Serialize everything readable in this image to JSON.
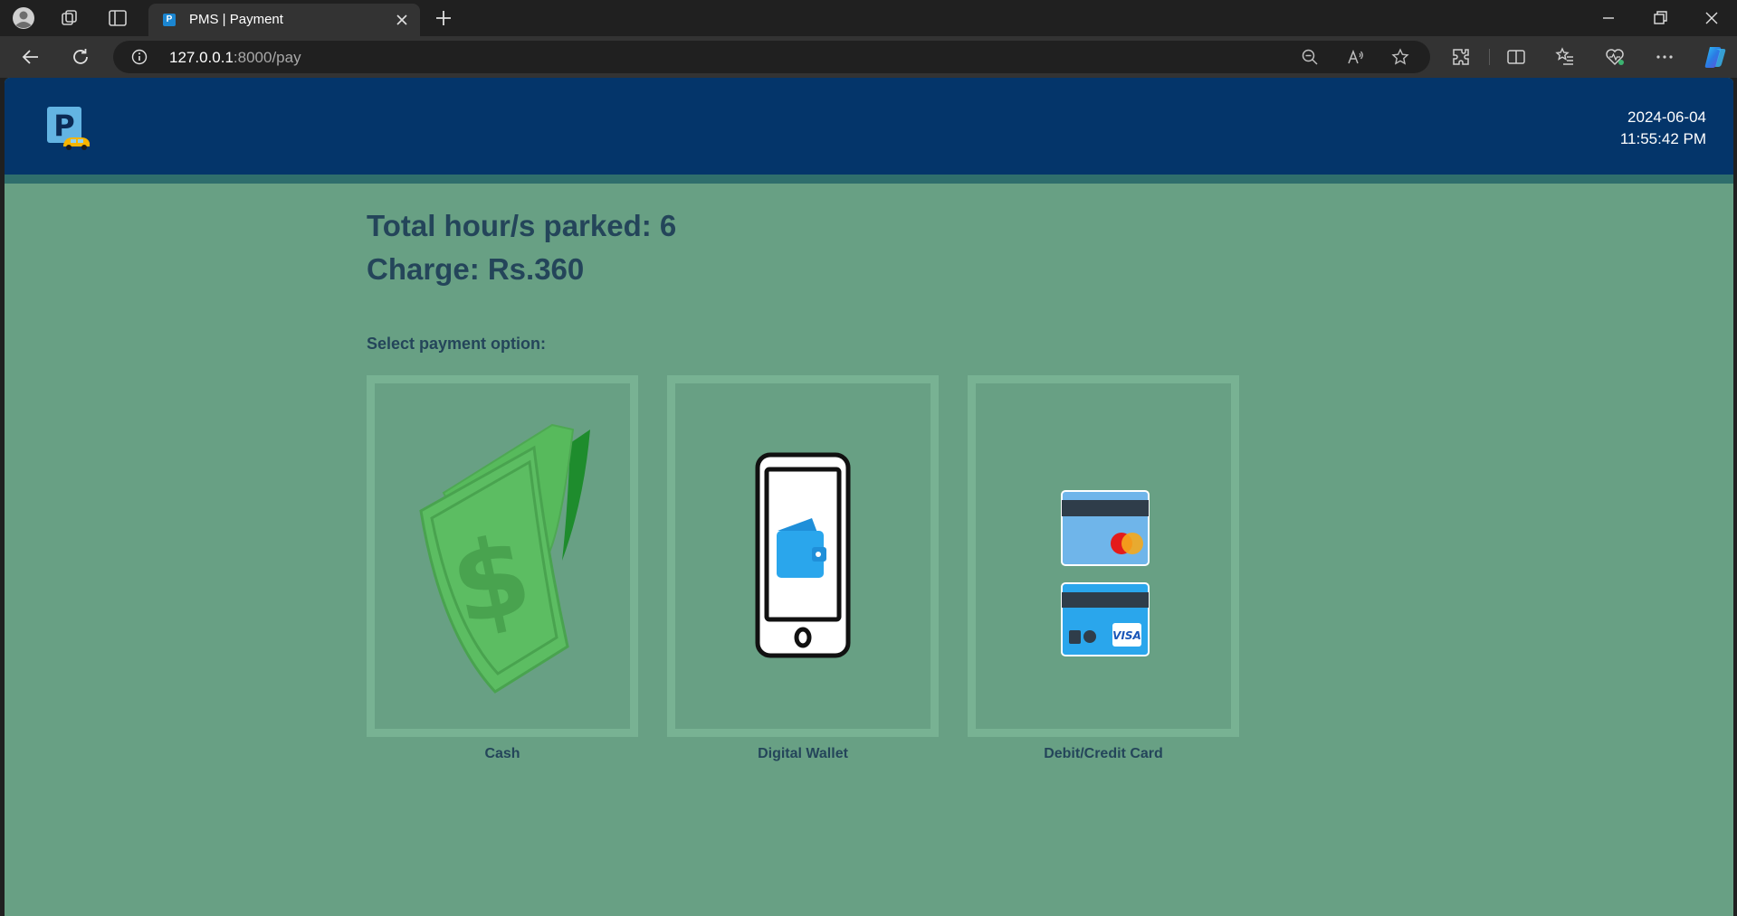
{
  "browser": {
    "tab_title": "PMS | Payment",
    "url_host": "127.0.0.1",
    "url_rest": ":8000/pay"
  },
  "header": {
    "date": "2024-06-04",
    "time": "11:55:42 PM"
  },
  "summary": {
    "hours_line": "Total hour/s parked: 6",
    "charge_line": "Charge: Rs.360"
  },
  "payment": {
    "prompt": "Select payment option:",
    "options": [
      {
        "label": "Cash",
        "icon": "cash-icon"
      },
      {
        "label": "Digital Wallet",
        "icon": "digital-wallet-icon"
      },
      {
        "label": "Debit/Credit Card",
        "icon": "card-icon"
      }
    ]
  },
  "colors": {
    "header_bg": "#04356a",
    "page_bg": "#68a084",
    "text": "#24455a",
    "option_border": "#78b293"
  }
}
